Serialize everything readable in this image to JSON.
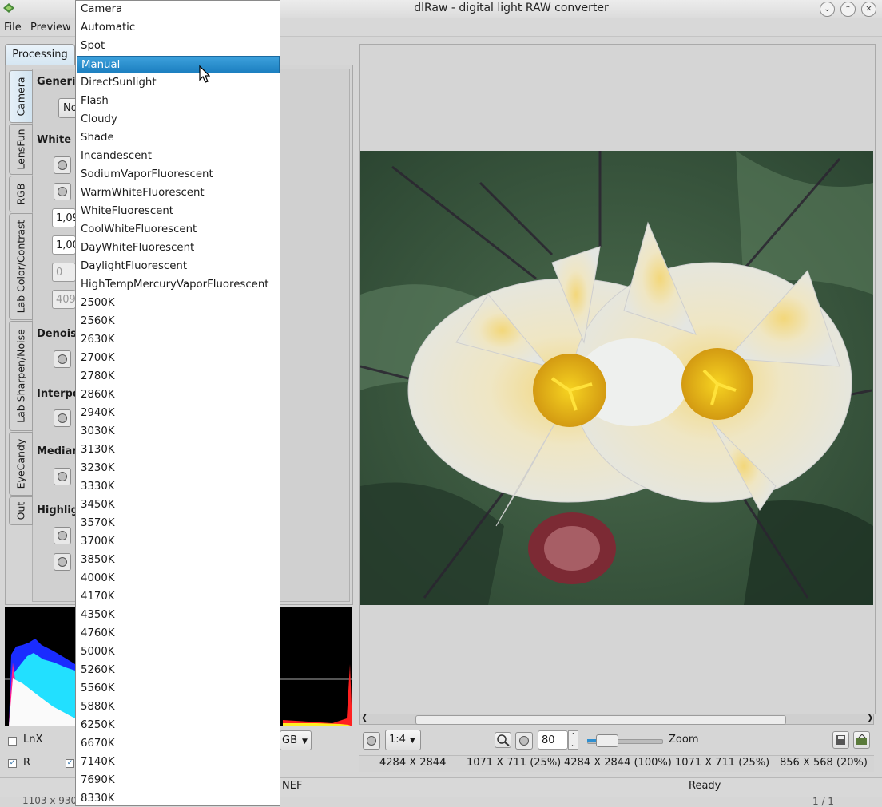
{
  "window": {
    "title": "dlRaw - digital light RAW converter"
  },
  "menu": {
    "file": "File",
    "preview": "Preview"
  },
  "tabs": {
    "processing": "Processing"
  },
  "side_tabs": [
    "Camera",
    "LensFun",
    "RGB",
    "Lab Color/Contrast",
    "Lab Sharpen/Noise",
    "EyeCandy",
    "Out"
  ],
  "sections": {
    "generic": "Generi",
    "white": "White",
    "denoise": "Denois",
    "interpolation": "Interpo",
    "median": "Median",
    "highlight": "Highlig"
  },
  "generic_combo": "No",
  "fields": {
    "f1": "1,09",
    "f2": "1,00",
    "f3": "0",
    "f4": "409"
  },
  "bottom_left": {
    "lnx": "LnX",
    "r": "R"
  },
  "preview_controls": {
    "ratio": "1:4",
    "zoom_value": "80",
    "zoom_label": "Zoom",
    "channel": "GB"
  },
  "status": {
    "sizes": [
      "4284 X 2844",
      "1071 X 711 (25%)",
      "4284 X 2844 (100%)",
      "1071 X 711 (25%)",
      "856 X 568 (20%)"
    ],
    "filename_suffix": "NEF",
    "state": "Ready",
    "left_info": "1103 x 930",
    "page": "1 / 1"
  },
  "dropdown": {
    "selected": "Manual",
    "options": [
      "Camera",
      "Automatic",
      "Spot",
      "Manual",
      "DirectSunlight",
      "Flash",
      "Cloudy",
      "Shade",
      "Incandescent",
      "SodiumVaporFluorescent",
      "WarmWhiteFluorescent",
      "WhiteFluorescent",
      "CoolWhiteFluorescent",
      "DayWhiteFluorescent",
      "DaylightFluorescent",
      "HighTempMercuryVaporFluorescent",
      "2500K",
      "2560K",
      "2630K",
      "2700K",
      "2780K",
      "2860K",
      "2940K",
      "3030K",
      "3130K",
      "3230K",
      "3330K",
      "3450K",
      "3570K",
      "3700K",
      "3850K",
      "4000K",
      "4170K",
      "4350K",
      "4760K",
      "5000K",
      "5260K",
      "5560K",
      "5880K",
      "6250K",
      "6670K",
      "7140K",
      "7690K",
      "8330K"
    ]
  },
  "colors": {
    "selection": "#1c7fc0",
    "histogram_bg": "#000000"
  }
}
